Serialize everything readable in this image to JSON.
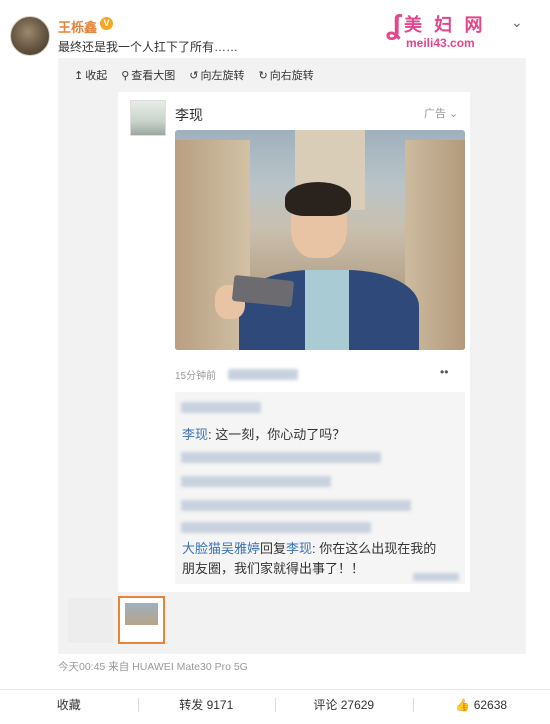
{
  "post": {
    "username": "王栎鑫",
    "verified_badge": "V",
    "text": "最终还是我一个人扛下了所有……",
    "menu_icon": "chevron-down-icon"
  },
  "watermark": {
    "title": "美 妇 网",
    "site": "meili43.com"
  },
  "toolbar": {
    "collapse": "收起",
    "view_large": "查看大图",
    "rotate_left": "向左旋转",
    "rotate_right": "向右旋转"
  },
  "ad_card": {
    "name": "李现",
    "tag": "广告",
    "time": "15分钟前",
    "comments": [
      {
        "name": "李现",
        "text": ": 这一刻，你心动了吗？"
      },
      {
        "name": "大脸猫吴雅婷",
        "reply_word": "回复",
        "reply_to": "李现",
        "text": ": 你在这么出现在我的",
        "text2": "朋友圈，我们家就得出事了！！"
      }
    ]
  },
  "meta": {
    "time": "今天00:45",
    "source": "来自 HUAWEI Mate30 Pro 5G"
  },
  "actions": {
    "collect": "收藏",
    "repost": "转发 9171",
    "comment": "评论 27629",
    "like": "62638"
  },
  "colors": {
    "username": "#e8833a",
    "link_blue": "#3a72b8",
    "watermark_pink": "#e4468a"
  }
}
